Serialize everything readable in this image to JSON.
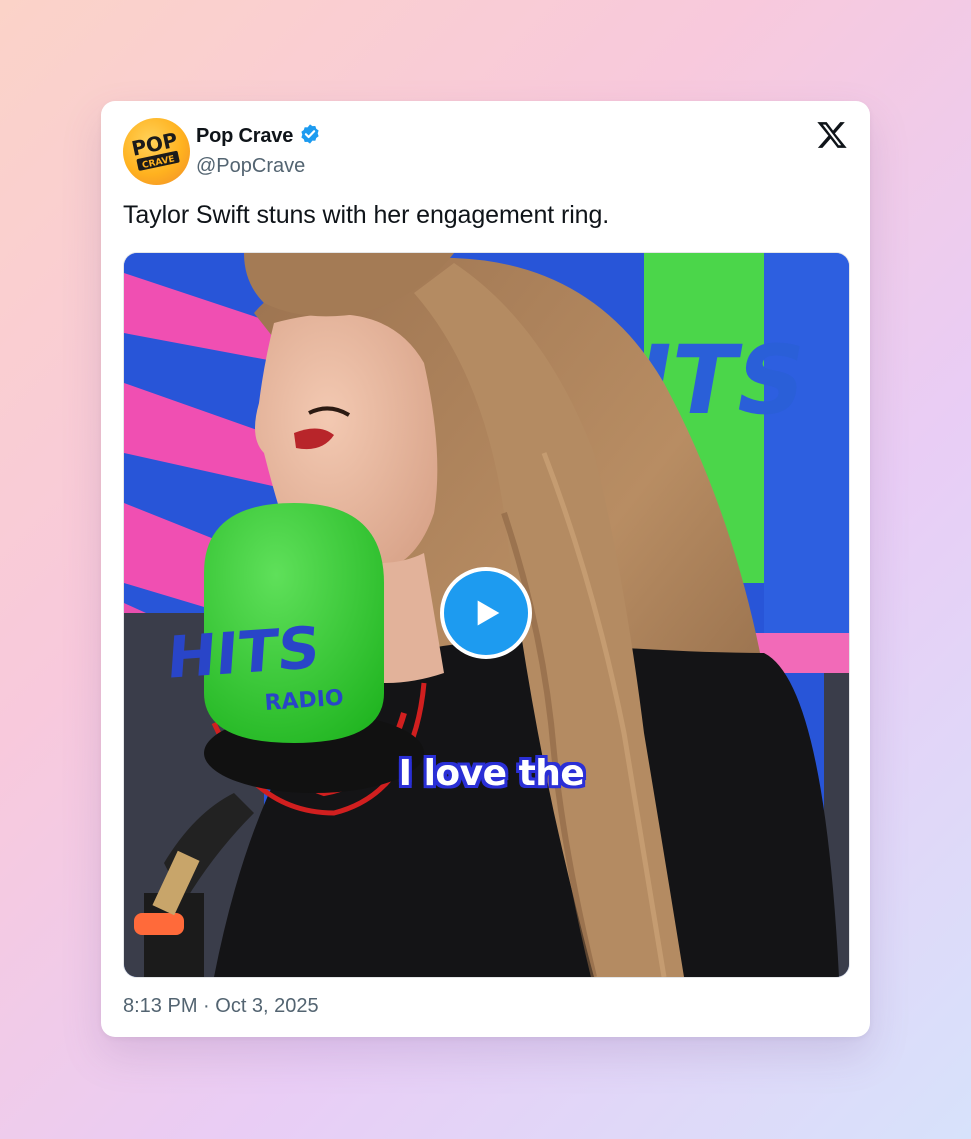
{
  "account": {
    "display_name": "Pop Crave",
    "handle": "@PopCrave",
    "verified": true,
    "avatar_text_top": "POP",
    "avatar_text_bottom": "CRAVE"
  },
  "tweet": {
    "text": "Taylor Swift stuns with her engagement ring.",
    "timestamp": "8:13 PM · Oct 3, 2025"
  },
  "media": {
    "type": "video",
    "caption": "I love the",
    "mic_label_top": "HITS",
    "mic_label_bottom": "RADIO",
    "background_sign": "ITS"
  },
  "icons": {
    "platform": "x-logo-icon",
    "verified": "verified-badge-icon",
    "play": "play-icon"
  },
  "colors": {
    "accent_blue": "#1d9bf0",
    "text_primary": "#0f1419",
    "text_secondary": "#536471",
    "caption_outline": "#2a2fd6",
    "mic_green": "#3ccf3a"
  }
}
